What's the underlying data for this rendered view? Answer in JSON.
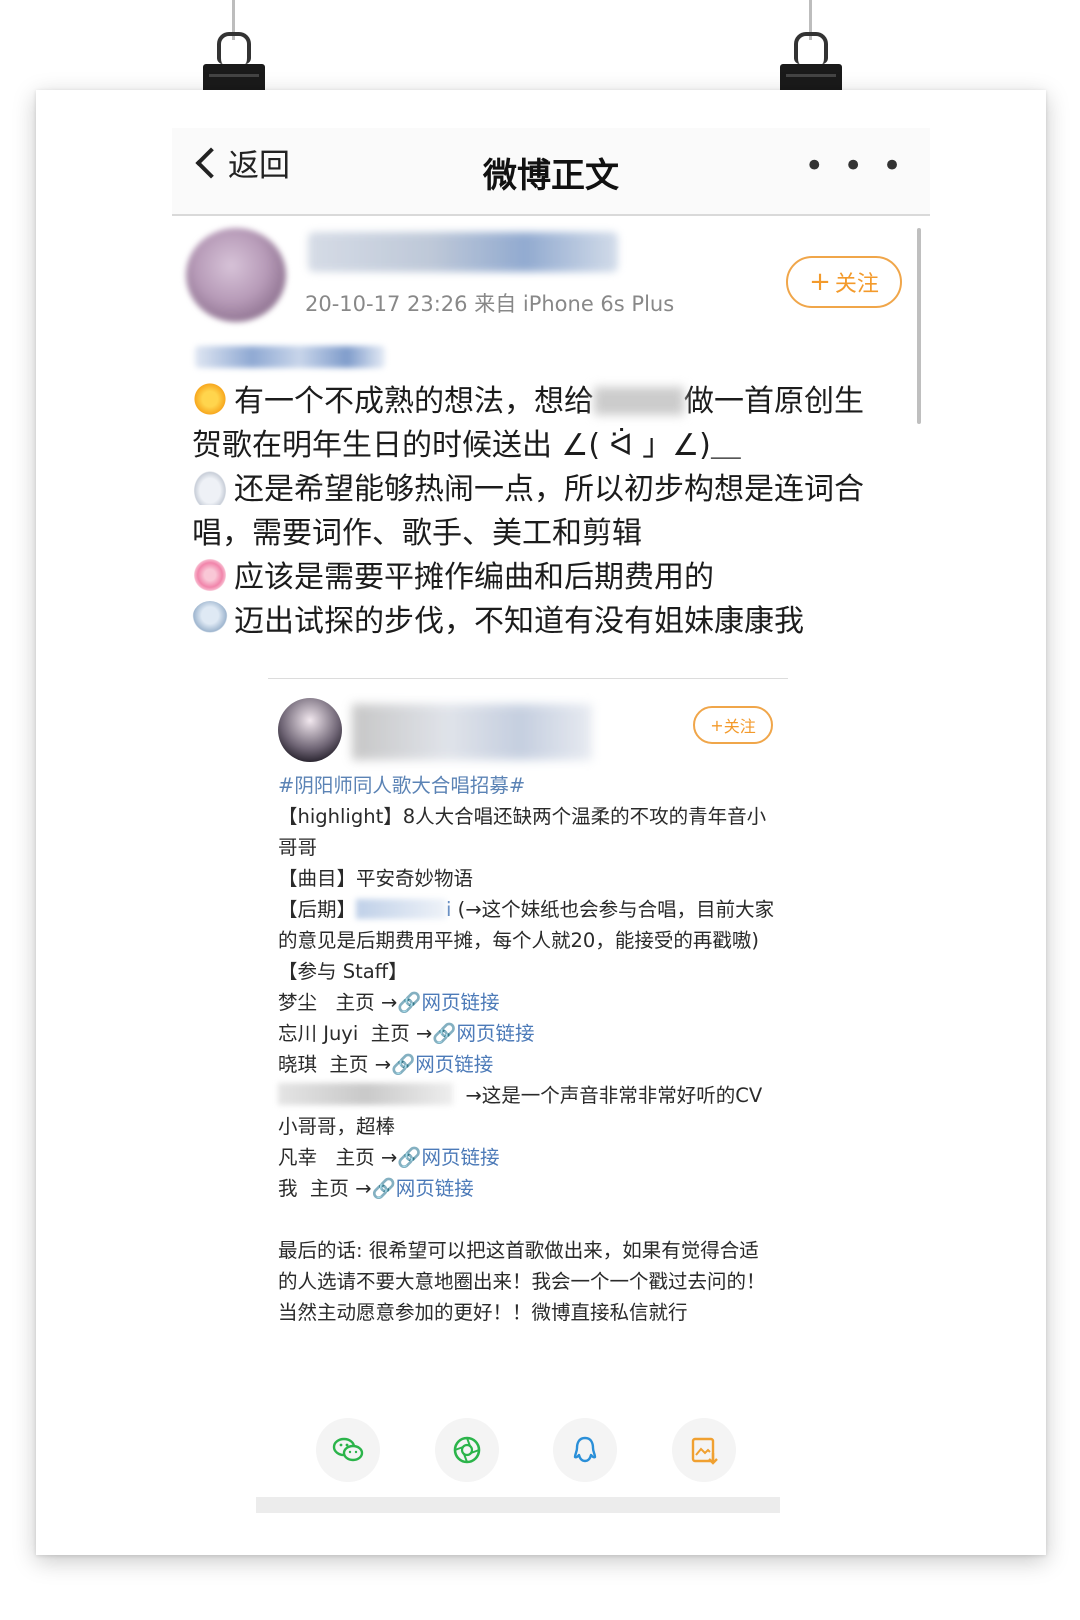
{
  "nav": {
    "back_label": "返回",
    "title": "微博正文",
    "more_label": "• • •"
  },
  "post": {
    "meta": "20-10-17 23:26  来自 iPhone 6s Plus",
    "follow_label": "关注",
    "lines": [
      "有一个不成熟的想法，想给",
      "做一首原创生贺歌在明年生日的时候送出 ∠( ᐛ 」∠)＿",
      "还是希望能够热闹一点，所以初步构想是连词合唱，需要词作、歌手、美工和剪辑",
      "应该是需要平摊作编曲和后期费用的",
      "迈出试探的步伐，不知道有没有姐妹康康我"
    ]
  },
  "repost": {
    "follow_label": "关注",
    "hashtag": "#阴阳师同人歌大合唱招募#",
    "highlight": "【highlight】8人大合唱还缺两个温柔的不攻的青年音小哥哥",
    "song": "【曲目】平安奇妙物语",
    "postprod_label": "【后期】",
    "postprod_tail": "i",
    "postprod_note": "(→这个妹纸也会参与合唱，目前大家的意见是后期费用平摊，每个人就20，能接受的再戳嗷)",
    "staff_label": "【参与 Staff】",
    "staff": [
      {
        "name": "梦尘",
        "home": "主页 →",
        "link": "🔗网页链接"
      },
      {
        "name": "忘川 Juyi",
        "home": "主页 →",
        "link": "🔗网页链接"
      },
      {
        "name": "晓琪",
        "home": "主页 →",
        "link": "🔗网页链接"
      }
    ],
    "cv_note": "→这是一个声音非常非常好听的CV小哥哥，超棒",
    "staff2": [
      {
        "name": "凡幸",
        "home": "主页 →",
        "link": "🔗网页链接"
      },
      {
        "name": "我",
        "home": "主页 →",
        "link": "🔗网页链接"
      }
    ],
    "closing": "最后的话: 很希望可以把这首歌做出来，如果有觉得合适的人选请不要大意地圈出来！我会一个一个戳过去问的！当然主动愿意参加的更好！！微博直接私信就行"
  },
  "share": [
    "wechat-icon",
    "moments-icon",
    "qq-icon",
    "save-image-icon"
  ],
  "colors": {
    "follow_orange": "#f39a2b",
    "link_blue": "#4c7ab8",
    "wechat_green": "#2bb44a",
    "qq_blue": "#2a8fd8",
    "save_orange": "#f0a030"
  }
}
